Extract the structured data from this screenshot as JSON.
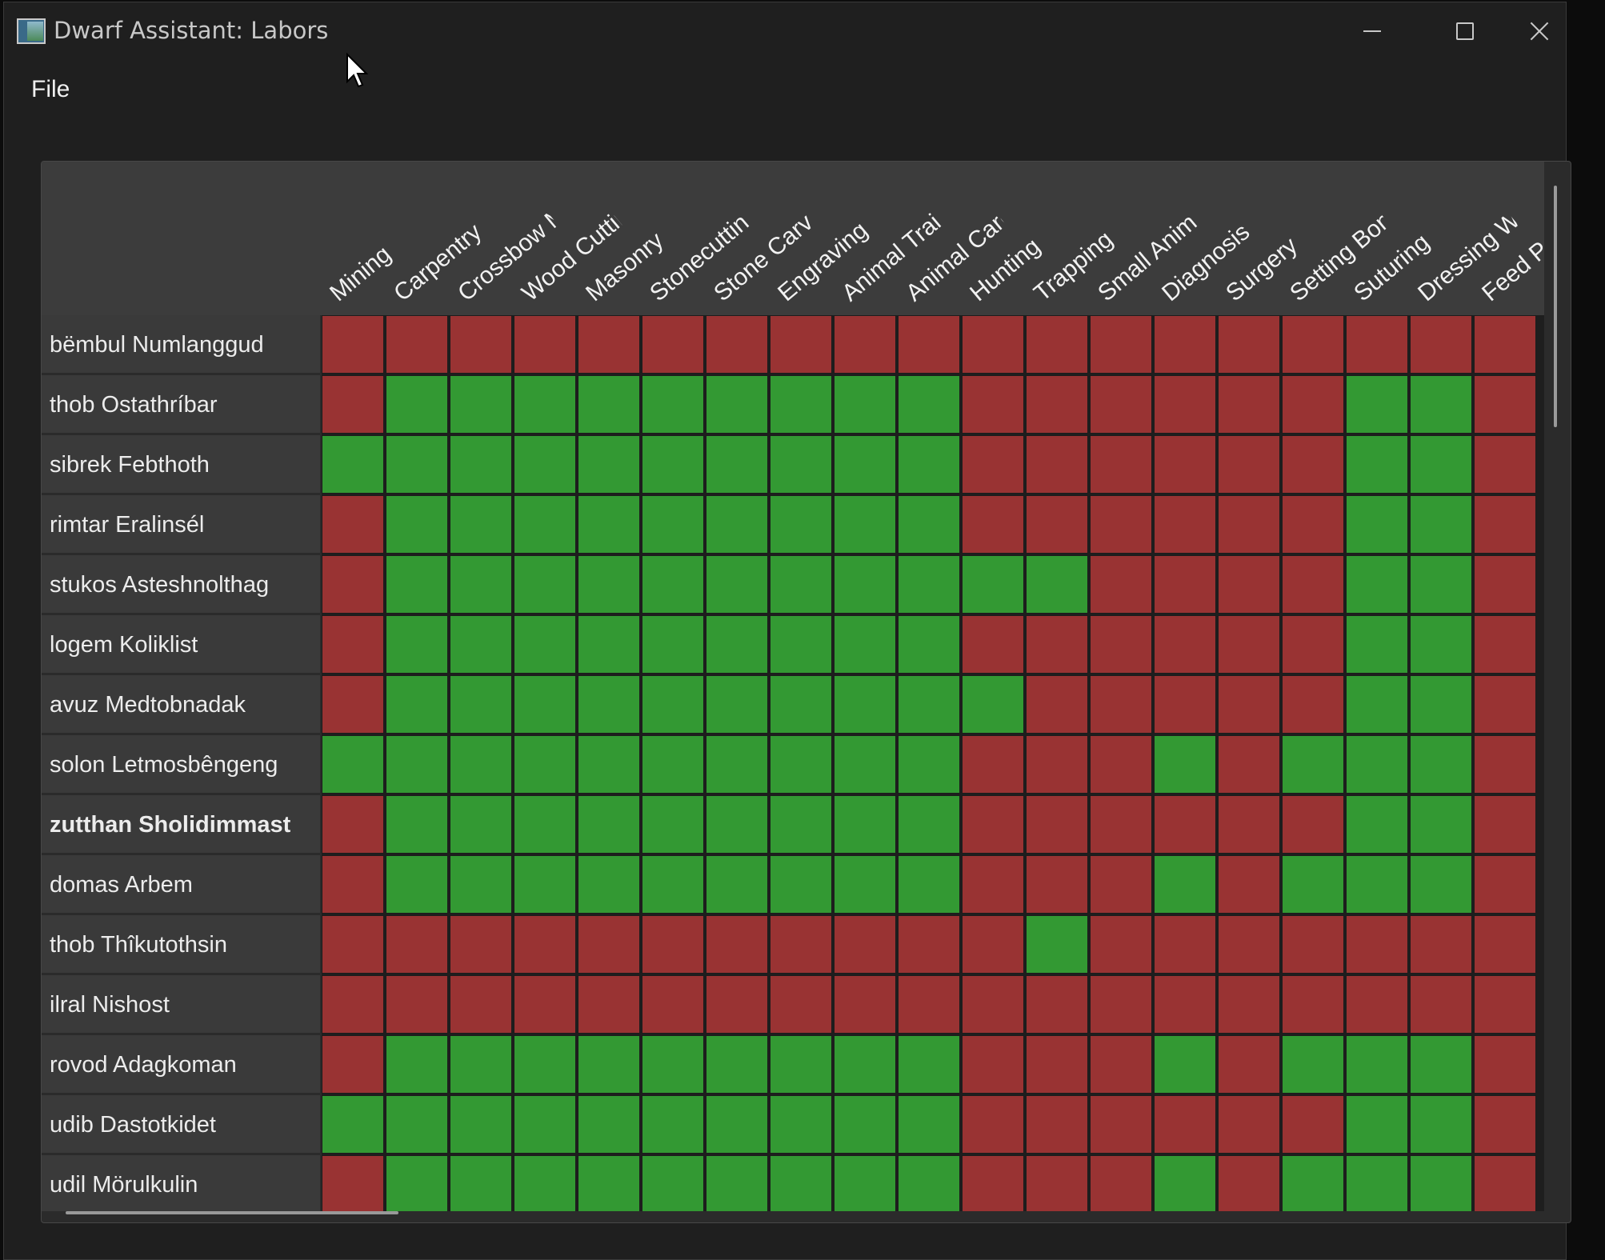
{
  "window": {
    "title": "Dwarf Assistant: Labors"
  },
  "menu": {
    "file_label": "File"
  },
  "colors": {
    "enabled": "#339933",
    "disabled": "#993333",
    "header_bg": "#3c3c3c",
    "window_bg": "#1f1f1f"
  },
  "columns": [
    "Mining",
    "Carpentry",
    "Crossbow Making",
    "Wood Cutting",
    "Masonry",
    "Stonecutting",
    "Stone Carving",
    "Engraving",
    "Animal Training",
    "Animal Care",
    "Hunting",
    "Trapping",
    "Small Animal Dissection",
    "Diagnosis",
    "Surgery",
    "Setting Bones",
    "Suturing",
    "Dressing Wounds",
    "Feed Patients/Prisoners"
  ],
  "rows": [
    {
      "name": "bëmbul Numlanggud",
      "bold": false,
      "labors": [
        0,
        0,
        0,
        0,
        0,
        0,
        0,
        0,
        0,
        0,
        0,
        0,
        0,
        0,
        0,
        0,
        0,
        0,
        0
      ]
    },
    {
      "name": "thob Ostathríbar",
      "bold": false,
      "labors": [
        0,
        1,
        1,
        1,
        1,
        1,
        1,
        1,
        1,
        1,
        0,
        0,
        0,
        0,
        0,
        0,
        1,
        1,
        0
      ]
    },
    {
      "name": "sibrek Febthoth",
      "bold": false,
      "labors": [
        1,
        1,
        1,
        1,
        1,
        1,
        1,
        1,
        1,
        1,
        0,
        0,
        0,
        0,
        0,
        0,
        1,
        1,
        0
      ]
    },
    {
      "name": "rimtar Eralinsél",
      "bold": false,
      "labors": [
        0,
        1,
        1,
        1,
        1,
        1,
        1,
        1,
        1,
        1,
        0,
        0,
        0,
        0,
        0,
        0,
        1,
        1,
        0
      ]
    },
    {
      "name": "stukos Asteshnolthag",
      "bold": false,
      "labors": [
        0,
        1,
        1,
        1,
        1,
        1,
        1,
        1,
        1,
        1,
        1,
        1,
        0,
        0,
        0,
        0,
        1,
        1,
        0
      ]
    },
    {
      "name": "logem Koliklist",
      "bold": false,
      "labors": [
        0,
        1,
        1,
        1,
        1,
        1,
        1,
        1,
        1,
        1,
        0,
        0,
        0,
        0,
        0,
        0,
        1,
        1,
        0
      ]
    },
    {
      "name": "avuz Medtobnadak",
      "bold": false,
      "labors": [
        0,
        1,
        1,
        1,
        1,
        1,
        1,
        1,
        1,
        1,
        1,
        0,
        0,
        0,
        0,
        0,
        1,
        1,
        0
      ]
    },
    {
      "name": "solon Letmosbêngeng",
      "bold": false,
      "labors": [
        1,
        1,
        1,
        1,
        1,
        1,
        1,
        1,
        1,
        1,
        0,
        0,
        0,
        1,
        0,
        1,
        1,
        1,
        0
      ]
    },
    {
      "name": "zutthan Sholidimmast",
      "bold": true,
      "labors": [
        0,
        1,
        1,
        1,
        1,
        1,
        1,
        1,
        1,
        1,
        0,
        0,
        0,
        0,
        0,
        0,
        1,
        1,
        0
      ]
    },
    {
      "name": "domas Arbem",
      "bold": false,
      "labors": [
        0,
        1,
        1,
        1,
        1,
        1,
        1,
        1,
        1,
        1,
        0,
        0,
        0,
        1,
        0,
        1,
        1,
        1,
        0
      ]
    },
    {
      "name": "thob Thîkutothsin",
      "bold": false,
      "labors": [
        0,
        0,
        0,
        0,
        0,
        0,
        0,
        0,
        0,
        0,
        0,
        1,
        0,
        0,
        0,
        0,
        0,
        0,
        0
      ]
    },
    {
      "name": "ilral Nishost",
      "bold": false,
      "labors": [
        0,
        0,
        0,
        0,
        0,
        0,
        0,
        0,
        0,
        0,
        0,
        0,
        0,
        0,
        0,
        0,
        0,
        0,
        0
      ]
    },
    {
      "name": "rovod Adagkoman",
      "bold": false,
      "labors": [
        0,
        1,
        1,
        1,
        1,
        1,
        1,
        1,
        1,
        1,
        0,
        0,
        0,
        1,
        0,
        1,
        1,
        1,
        0
      ]
    },
    {
      "name": "udib Dastotkidet",
      "bold": false,
      "labors": [
        1,
        1,
        1,
        1,
        1,
        1,
        1,
        1,
        1,
        1,
        0,
        0,
        0,
        0,
        0,
        0,
        1,
        1,
        0
      ]
    },
    {
      "name": "udil Mörulkulin",
      "bold": false,
      "labors": [
        0,
        1,
        1,
        1,
        1,
        1,
        1,
        1,
        1,
        1,
        0,
        0,
        0,
        1,
        0,
        1,
        1,
        1,
        0
      ]
    }
  ]
}
